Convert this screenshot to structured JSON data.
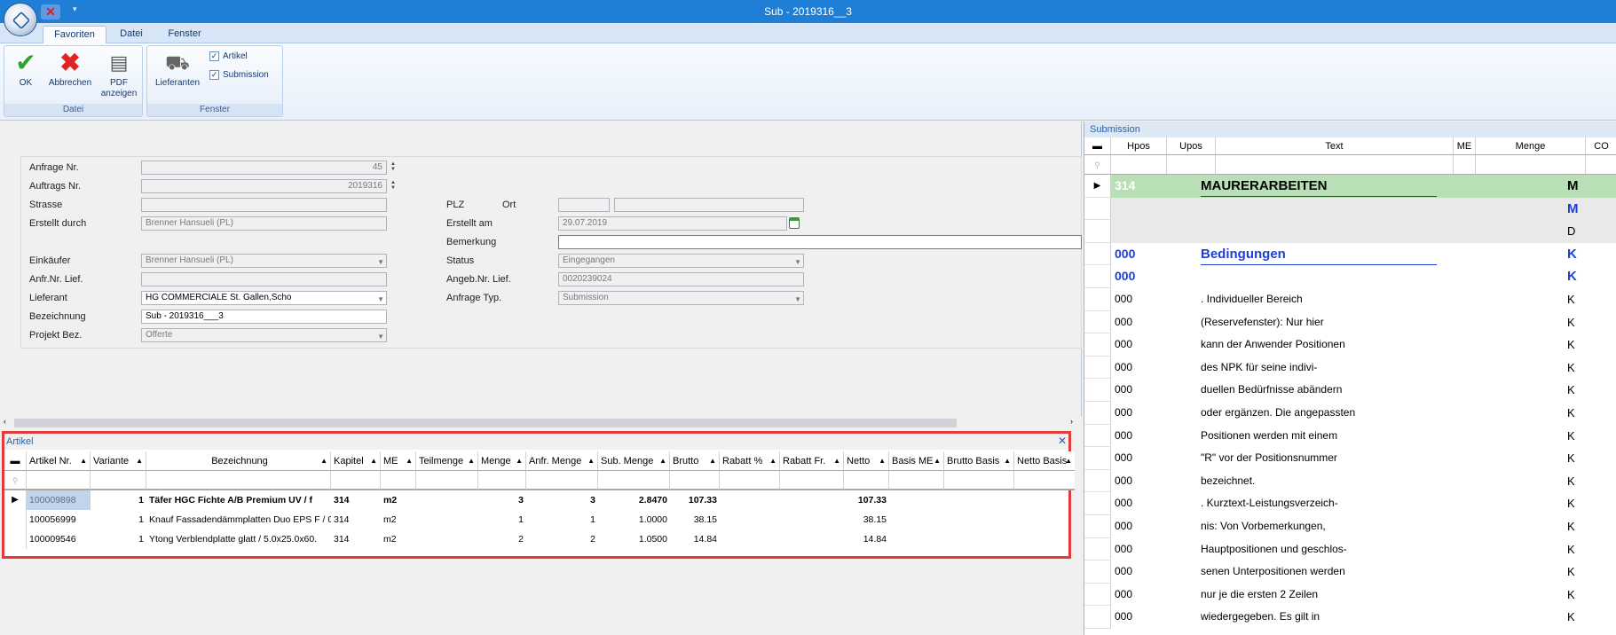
{
  "titlebar": {
    "title": "Sub - 2019316__3",
    "close_glyph": "✕",
    "qat_arrow": "▾"
  },
  "ribbon": {
    "tabs": [
      "Favoriten",
      "Datei",
      "Fenster"
    ],
    "groups": {
      "datei": {
        "label": "Datei",
        "ok": "OK",
        "abbrechen": "Abbrechen",
        "pdf_line1": "PDF",
        "pdf_line2": "anzeigen"
      },
      "fenster": {
        "label": "Fenster",
        "lieferanten": "Lieferanten",
        "artikel": "Artikel",
        "submission": "Submission"
      }
    }
  },
  "form": {
    "anfrage_nr": {
      "label": "Anfrage Nr.",
      "value": "45"
    },
    "auftrags_nr": {
      "label": "Auftrags Nr.",
      "value": "2019316"
    },
    "strasse": {
      "label": "Strasse",
      "value": ""
    },
    "erstellt_durch": {
      "label": "Erstellt durch",
      "value": "Brenner Hansueli (PL)"
    },
    "einkaeufer": {
      "label": "Einkäufer",
      "value": "Brenner Hansueli (PL)"
    },
    "anfr_nr_lief": {
      "label": "Anfr.Nr. Lief.",
      "value": ""
    },
    "lieferant": {
      "label": "Lieferant",
      "value": "HG COMMERCIALE St. Gallen,Scho"
    },
    "bezeichnung": {
      "label": "Bezeichnung",
      "value": "Sub - 2019316___3"
    },
    "projekt_bez": {
      "label": "Projekt Bez.",
      "value": "Offerte"
    },
    "plz": {
      "label": "PLZ",
      "value": ""
    },
    "ort": {
      "label": "Ort",
      "value": ""
    },
    "erstellt_am": {
      "label": "Erstellt am",
      "value": "29.07.2019"
    },
    "bemerkung": {
      "label": "Bemerkung",
      "value": ""
    },
    "status": {
      "label": "Status",
      "value": "Eingegangen"
    },
    "angeb_nr_lief": {
      "label": "Angeb.Nr. Lief.",
      "value": "0020239024"
    },
    "anfrage_typ": {
      "label": "Anfrage Typ.",
      "value": "Submission"
    }
  },
  "artikel": {
    "caption": "Artikel",
    "columns": [
      "Artikel Nr.",
      "Variante",
      "Bezeichnung",
      "Kapitel",
      "ME",
      "Teilmenge",
      "Menge",
      "Anfr. Menge",
      "Sub. Menge",
      "Brutto",
      "Rabatt %",
      "Rabatt Fr.",
      "Netto",
      "Basis ME",
      "Brutto Basis",
      "Netto Basis"
    ],
    "rows": [
      {
        "artikel_nr": "100009898",
        "variante": "1",
        "bezeichnung": "Täfer HGC Fichte A/B Premium UV / f",
        "kapitel": "314",
        "me": "m2",
        "menge": "3",
        "anfr_menge": "3",
        "sub_menge": "2.8470",
        "brutto": "107.33",
        "netto": "107.33"
      },
      {
        "artikel_nr": "100056999",
        "variante": "1",
        "bezeichnung": "Knauf Fassadendämmplatten Duo EPS F / 0",
        "kapitel": "314",
        "me": "m2",
        "menge": "1",
        "anfr_menge": "1",
        "sub_menge": "1.0000",
        "brutto": "38.15",
        "netto": "38.15"
      },
      {
        "artikel_nr": "100009546",
        "variante": "1",
        "bezeichnung": "Ytong Verblendplatte glatt / 5.0x25.0x60.",
        "kapitel": "314",
        "me": "m2",
        "menge": "2",
        "anfr_menge": "2",
        "sub_menge": "1.0500",
        "brutto": "14.84",
        "netto": "14.84"
      }
    ]
  },
  "submission": {
    "caption": "Submission",
    "columns": [
      "Hpos",
      "Upos",
      "Text",
      "ME",
      "Menge",
      "CO"
    ],
    "rows": [
      {
        "hpos": "314",
        "text": "MAURERARBEITEN",
        "co": "M"
      },
      {
        "hpos": "",
        "text": "",
        "co": "M"
      },
      {
        "hpos": "",
        "text": "",
        "co": "D"
      },
      {
        "hpos": "000",
        "text": "Bedingungen",
        "co": "K"
      },
      {
        "hpos": "000",
        "text": "",
        "co": "K"
      },
      {
        "hpos": "000",
        "text": ". Individueller Bereich",
        "co": "K"
      },
      {
        "hpos": "000",
        "text": "(Reservefenster): Nur hier",
        "co": "K"
      },
      {
        "hpos": "000",
        "text": "kann der Anwender Positionen",
        "co": "K"
      },
      {
        "hpos": "000",
        "text": "des NPK für seine indivi-",
        "co": "K"
      },
      {
        "hpos": "000",
        "text": "duellen Bedürfnisse abändern",
        "co": "K"
      },
      {
        "hpos": "000",
        "text": "oder ergänzen. Die angepassten",
        "co": "K"
      },
      {
        "hpos": "000",
        "text": "Positionen werden mit einem",
        "co": "K"
      },
      {
        "hpos": "000",
        "text": "\"R\" vor der Positionsnummer",
        "co": "K"
      },
      {
        "hpos": "000",
        "text": "bezeichnet.",
        "co": "K"
      },
      {
        "hpos": "000",
        "text": ". Kurztext-Leistungsverzeich-",
        "co": "K"
      },
      {
        "hpos": "000",
        "text": "nis: Von Vorbemerkungen,",
        "co": "K"
      },
      {
        "hpos": "000",
        "text": "Hauptpositionen und geschlos-",
        "co": "K"
      },
      {
        "hpos": "000",
        "text": "senen Unterpositionen werden",
        "co": "K"
      },
      {
        "hpos": "000",
        "text": "nur je die ersten 2 Zeilen",
        "co": "K"
      },
      {
        "hpos": "000",
        "text": "wiedergegeben. Es gilt in",
        "co": "K"
      }
    ]
  }
}
